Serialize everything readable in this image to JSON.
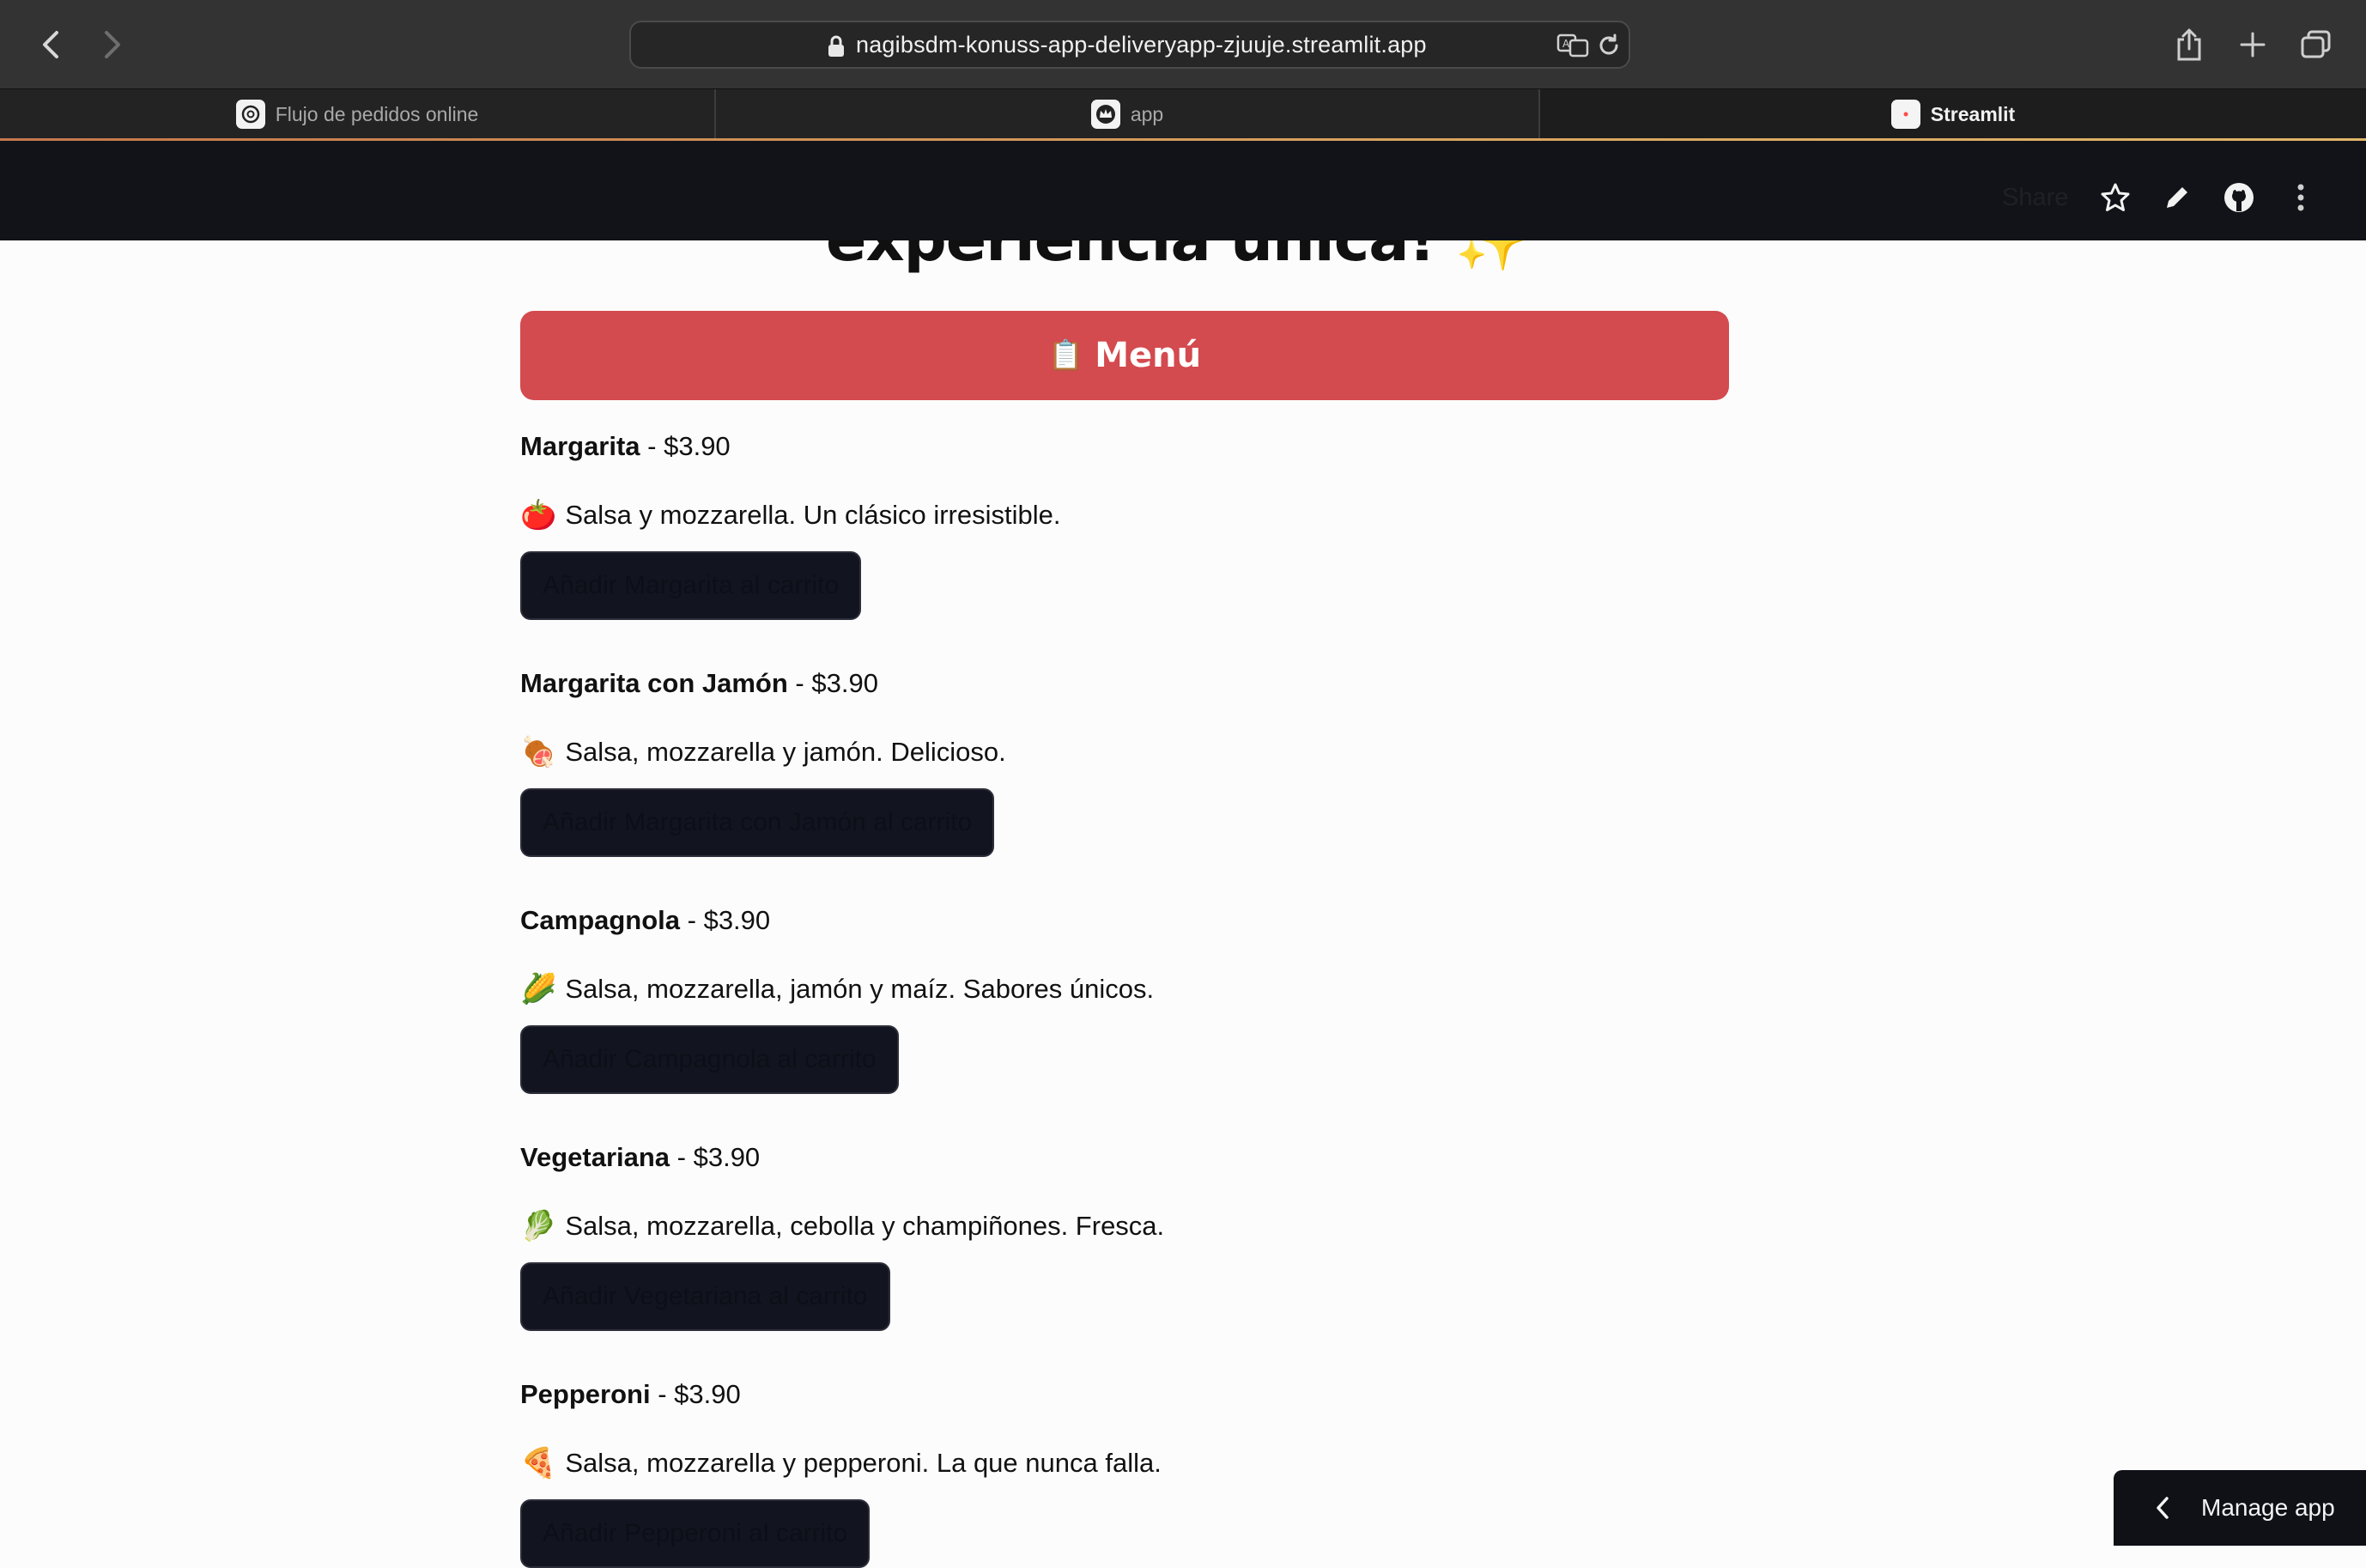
{
  "browser": {
    "url": "nagibsdm-konuss-app-deliveryapp-zjuuje.streamlit.app",
    "tabs": [
      {
        "label": "Flujo de pedidos online",
        "icon": "openai-icon"
      },
      {
        "label": "app",
        "icon": "crown-icon"
      },
      {
        "label": "Streamlit",
        "icon": "streamlit-icon"
      }
    ]
  },
  "header": {
    "share_label": "Share"
  },
  "hero": {
    "title": "experiencia única! ✨"
  },
  "menu": {
    "button_label": "Menú",
    "button_icon": "📋",
    "accent_color": "#d34a4f"
  },
  "pizzas": [
    {
      "name": "Margarita",
      "price": " - $3.90",
      "icon": "🍅",
      "description": "Salsa y mozzarella. Un clásico irresistible.",
      "button": "Añadir Margarita al carrito"
    },
    {
      "name": "Margarita con Jamón",
      "price": " - $3.90",
      "icon": "🍖",
      "description": "Salsa, mozzarella y jamón. Delicioso.",
      "button": "Añadir Margarita con Jamón al carrito"
    },
    {
      "name": "Campagnola",
      "price": " - $3.90",
      "icon": "🌽",
      "description": "Salsa, mozzarella, jamón y maíz. Sabores únicos.",
      "button": "Añadir Campagnola al carrito"
    },
    {
      "name": "Vegetariana",
      "price": " - $3.90",
      "icon": "🥬",
      "description": "Salsa, mozzarella, cebolla y champiñones. Fresca.",
      "button": "Añadir Vegetariana al carrito"
    },
    {
      "name": "Pepperoni",
      "price": " - $3.90",
      "icon": "🍕",
      "description": "Salsa, mozzarella y pepperoni. La que nunca falla.",
      "button": "Añadir Pepperoni al carrito"
    }
  ],
  "footer": {
    "manage_app_label": "Manage app"
  }
}
